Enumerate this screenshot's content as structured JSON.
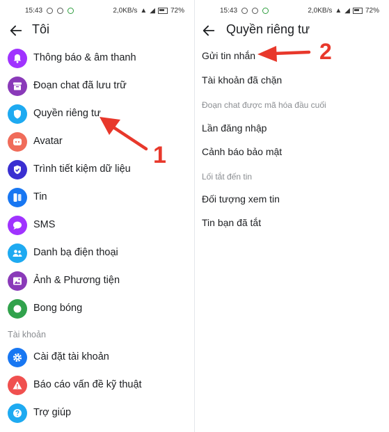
{
  "status_bar": {
    "time": "15:43",
    "network": "2,0KB/s",
    "battery": "72"
  },
  "left": {
    "title": "Tôi",
    "items": [
      {
        "label": "Thông báo & âm thanh",
        "icon": "bell-icon",
        "color": "#a033ff"
      },
      {
        "label": "Đoạn chat đã lưu trữ",
        "icon": "archive-icon",
        "color": "#8a3ab9"
      },
      {
        "label": "Quyền riêng tư",
        "icon": "shield-icon",
        "color": "#1eaaf1"
      },
      {
        "label": "Avatar",
        "icon": "avatar-icon",
        "color": "#f06c5a"
      },
      {
        "label": "Trình tiết kiệm dữ liệu",
        "icon": "data-saver-icon",
        "color": "#3a2fd1"
      },
      {
        "label": "Tin",
        "icon": "story-icon",
        "color": "#1877f2"
      },
      {
        "label": "SMS",
        "icon": "sms-icon",
        "color": "#a033ff"
      },
      {
        "label": "Danh bạ điện thoại",
        "icon": "contacts-icon",
        "color": "#1eaaf1"
      },
      {
        "label": "Ảnh & Phương tiện",
        "icon": "photo-icon",
        "color": "#8a3ab9"
      },
      {
        "label": "Bong bóng",
        "icon": "bubble-icon",
        "color": "#31a24c"
      }
    ],
    "section_account": "Tài khoản",
    "account_items": [
      {
        "label": "Cài đặt tài khoản",
        "icon": "gear-icon",
        "color": "#1877f2"
      },
      {
        "label": "Báo cáo vấn đề kỹ thuật",
        "icon": "warning-icon",
        "color": "#f0504f"
      },
      {
        "label": "Trợ giúp",
        "icon": "help-icon",
        "color": "#1eaaf1"
      }
    ],
    "annotation": "1"
  },
  "right": {
    "title": "Quyền riêng tư",
    "items": [
      "Gửi tin nhắn",
      "Tài khoản đã chặn"
    ],
    "section_encrypted": "Đoạn chat được mã hóa đầu cuối",
    "encrypted_items": [
      "Lần đăng nhập",
      "Cảnh báo bảo mật"
    ],
    "section_story": "Lối tắt đến tin",
    "story_items": [
      "Đối tượng xem tin",
      "Tin bạn đã tắt"
    ],
    "annotation": "2"
  },
  "annotation_color": "#e8382b"
}
